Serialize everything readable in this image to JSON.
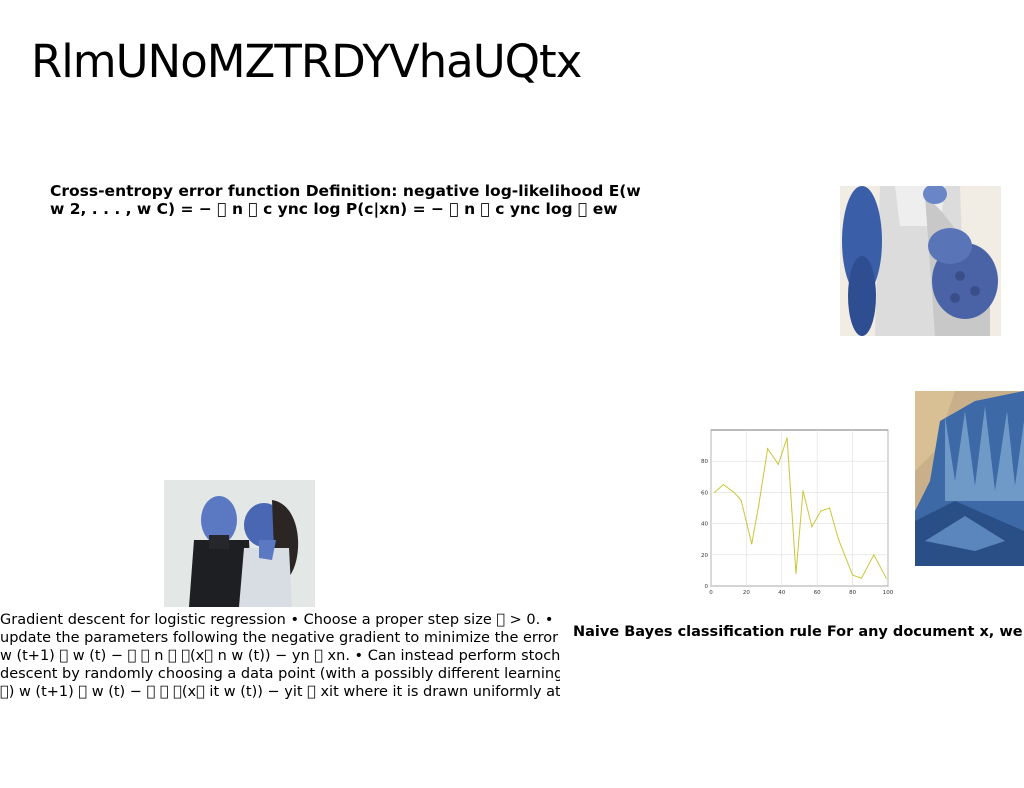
{
  "slide": {
    "title": "RlmUNoMZTRDYVhaUQtx"
  },
  "cross_entropy": {
    "lines": [
      "Cross-entropy error function Definition: negative log-likelihood E(w",
      "w 2, . . . , w C) = − \u0000 n \u0000 c ync log P(c|xn) = − \u0000 n \u0000 c ync log \u0000 ew"
    ]
  },
  "gradient_descent": {
    "lines": [
      "Gradient descent for logistic regression • Choose a proper step size \u0000 > 0. •",
      "update the parameters following the negative gradient to minimize the error",
      "w (t+1) \u0000 w (t) − \u0000 \u0000 n \u0000 \u0000(x\u0000 n w (t)) − yn \u0000 xn. • Can instead perform stochastic",
      "descent by randomly choosing a data point (with a possibly different learning",
      "\u0000) w (t+1) \u0000 w (t) − \u0000 \u0000 \u0000(x\u0000 it w (t)) − yit \u0000 xit where it is drawn uniformly at"
    ]
  },
  "naive_bayes": {
    "text": "Naive Bayes classification rule For any document x, we"
  },
  "images": {
    "sweater": "blue-knit-sweater-photo",
    "couple": "blue-painted-couple-photo",
    "glacier": "blue-glacier-photo"
  },
  "chart_data": {
    "type": "line",
    "title": "",
    "xlabel": "",
    "ylabel": "",
    "xlim": [
      0,
      100
    ],
    "ylim": [
      0,
      100
    ],
    "xticks": [
      0,
      20,
      40,
      60,
      80,
      100
    ],
    "yticks": [
      0,
      20,
      40,
      60,
      80
    ],
    "grid": true,
    "line_color": "#c8c83a",
    "series": [
      {
        "x": [
          2,
          7,
          13,
          17,
          23,
          27,
          32,
          38,
          43,
          48,
          52,
          57,
          62,
          67,
          72,
          80,
          85,
          92,
          99
        ],
        "y": [
          60,
          65,
          60,
          55,
          27,
          52,
          88,
          78,
          95,
          8,
          61,
          38,
          48,
          50,
          30,
          7,
          5,
          20,
          5
        ]
      }
    ]
  }
}
